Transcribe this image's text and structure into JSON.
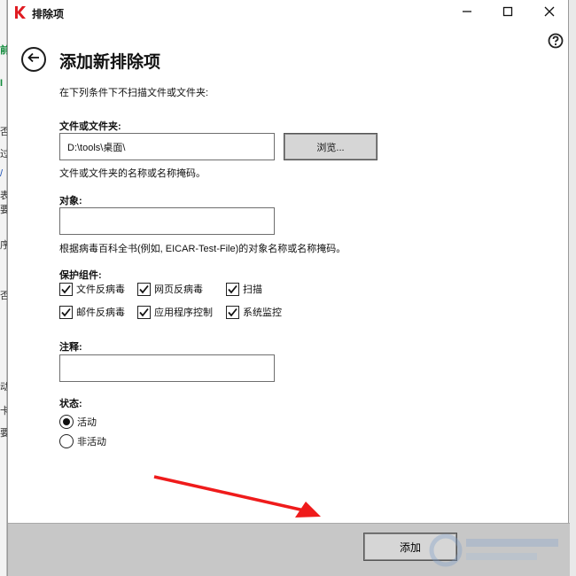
{
  "window": {
    "title": "排除项",
    "controls": [
      "minimize-icon",
      "maximize-icon",
      "close-icon"
    ]
  },
  "header": {
    "title": "添加新排除项",
    "intro": "在下列条件下不扫描文件或文件夹:"
  },
  "file_section": {
    "label": "文件或文件夹:",
    "value": "D:\\tools\\桌面\\",
    "browse_label": "浏览...",
    "hint": "文件或文件夹的名称或名称掩码。"
  },
  "object_section": {
    "label": "对象:",
    "value": "",
    "hint": "根据病毒百科全书(例如, EICAR-Test-File)的对象名称或名称掩码。"
  },
  "protection": {
    "label": "保护组件:",
    "components": [
      {
        "label": "文件反病毒",
        "checked": true
      },
      {
        "label": "网页反病毒",
        "checked": true
      },
      {
        "label": "扫描",
        "checked": true
      },
      {
        "label": "邮件反病毒",
        "checked": true
      },
      {
        "label": "应用程序控制",
        "checked": true
      },
      {
        "label": "系统监控",
        "checked": true
      }
    ]
  },
  "comment": {
    "label": "注释:",
    "value": ""
  },
  "status": {
    "label": "状态:",
    "options": [
      {
        "label": "活动",
        "selected": true
      },
      {
        "label": "非活动",
        "selected": false
      }
    ]
  },
  "footer": {
    "add_label": "添加"
  },
  "accent_colors": {
    "brand": "#e01b22",
    "annotation_arrow": "#ef1b1b"
  }
}
